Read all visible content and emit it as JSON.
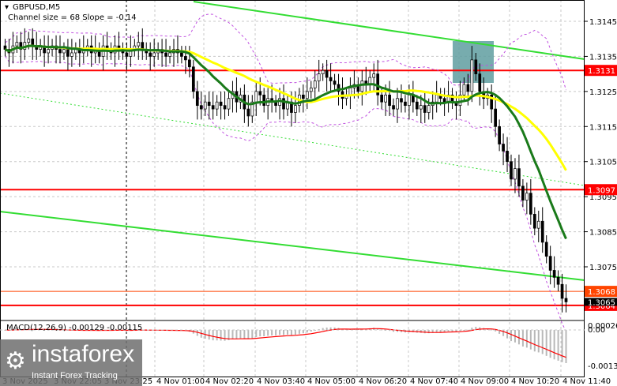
{
  "header": {
    "symbol": "GBPUSD,M5",
    "channel_info": "Channel size = 68 Slope = -0.14"
  },
  "macd": {
    "label": "MACD(12,26,9) -0.00129 -0.00115",
    "ticks": [
      "0.00026",
      "0.00",
      "-0.00136"
    ]
  },
  "logo": {
    "name": "instaforex",
    "tagline": "Instant Forex Tracking"
  },
  "colors": {
    "up_candle": "#ffffff",
    "down_candle": "#000000",
    "ma_fast": "#1a7a1a",
    "ma_slow": "#ffff00",
    "channel": "#33dd33",
    "level": "#ff0000",
    "box": "#5f9ea0",
    "macd_hist": "#b8b8b8",
    "macd_signal": "#ff0000"
  },
  "chart_data": {
    "type": "candlestick",
    "title": "GBPUSD,M5",
    "ylim": [
      1.3058,
      1.3151
    ],
    "y_ticks": [
      "1.3145",
      "1.3135",
      "1.3125",
      "1.3115",
      "1.3105",
      "1.3095",
      "1.3085",
      "1.3075"
    ],
    "y_tick_values": [
      1.3145,
      1.3135,
      1.3125,
      1.3115,
      1.3105,
      1.3095,
      1.3085,
      1.3075
    ],
    "levels": [
      {
        "label": "1.3131",
        "value": 1.3131,
        "color": "#ff0000"
      },
      {
        "label": "1.3097",
        "value": 1.3097,
        "color": "#ff0000"
      },
      {
        "label": "1.3064",
        "value": 1.3064,
        "color": "#ff0000"
      },
      {
        "label": "1.3068",
        "value": 1.3068,
        "color": "#ff4500"
      }
    ],
    "current_price": {
      "label": "1.3065",
      "value": 1.3065
    },
    "x_labels": [
      "3 Nov 2025",
      "3 Nov 22:05",
      "3 Nov 23:25",
      "4 Nov 01:00",
      "4 Nov 02:20",
      "4 Nov 03:40",
      "4 Nov 05:00",
      "4 Nov 06:20",
      "4 Nov 07:40",
      "4 Nov 09:00",
      "4 Nov 10:20",
      "4 Nov 11:40"
    ],
    "closes": [
      1.3137,
      1.3136,
      1.3138,
      1.3139,
      1.3137,
      1.3139,
      1.314,
      1.3138,
      1.3137,
      1.3138,
      1.3136,
      1.3137,
      1.3138,
      1.3137,
      1.3136,
      1.3137,
      1.3135,
      1.3136,
      1.3137,
      1.3136,
      1.3137,
      1.3138,
      1.3136,
      1.3137,
      1.3135,
      1.3138,
      1.3137,
      1.3136,
      1.3138,
      1.3137,
      1.3136,
      1.3135,
      1.3137,
      1.3138,
      1.3139,
      1.3137,
      1.3136,
      1.3135,
      1.3136,
      1.3137,
      1.3136,
      1.3135,
      1.3136,
      1.3137,
      1.3136,
      1.3135,
      1.3134,
      1.3132,
      1.3125,
      1.3121,
      1.312,
      1.3122,
      1.3121,
      1.312,
      1.3122,
      1.3121,
      1.312,
      1.3123,
      1.3125,
      1.3122,
      1.3124,
      1.312,
      1.3118,
      1.3122,
      1.3125,
      1.3124,
      1.3121,
      1.3123,
      1.3122,
      1.3121,
      1.3123,
      1.312,
      1.3122,
      1.3119,
      1.3121,
      1.3124,
      1.3123,
      1.3125,
      1.3126,
      1.3128,
      1.313,
      1.3131,
      1.3129,
      1.3128,
      1.3127,
      1.3125,
      1.3123,
      1.3124,
      1.3126,
      1.3127,
      1.3125,
      1.3128,
      1.3127,
      1.3129,
      1.313,
      1.3124,
      1.3122,
      1.3124,
      1.3121,
      1.312,
      1.3123,
      1.3122,
      1.3121,
      1.3124,
      1.3122,
      1.312,
      1.3121,
      1.3119,
      1.3121,
      1.3122,
      1.3124,
      1.3123,
      1.3122,
      1.3124,
      1.3122,
      1.3121,
      1.3124,
      1.3127,
      1.3125,
      1.3134,
      1.313,
      1.3125,
      1.3123,
      1.3124,
      1.312,
      1.3115,
      1.311,
      1.3108,
      1.3105,
      1.31,
      1.3103,
      1.3098,
      1.3094,
      1.3096,
      1.309,
      1.3086,
      1.3088,
      1.3082,
      1.3078,
      1.3074,
      1.3072,
      1.307,
      1.3066,
      1.3065
    ]
  }
}
